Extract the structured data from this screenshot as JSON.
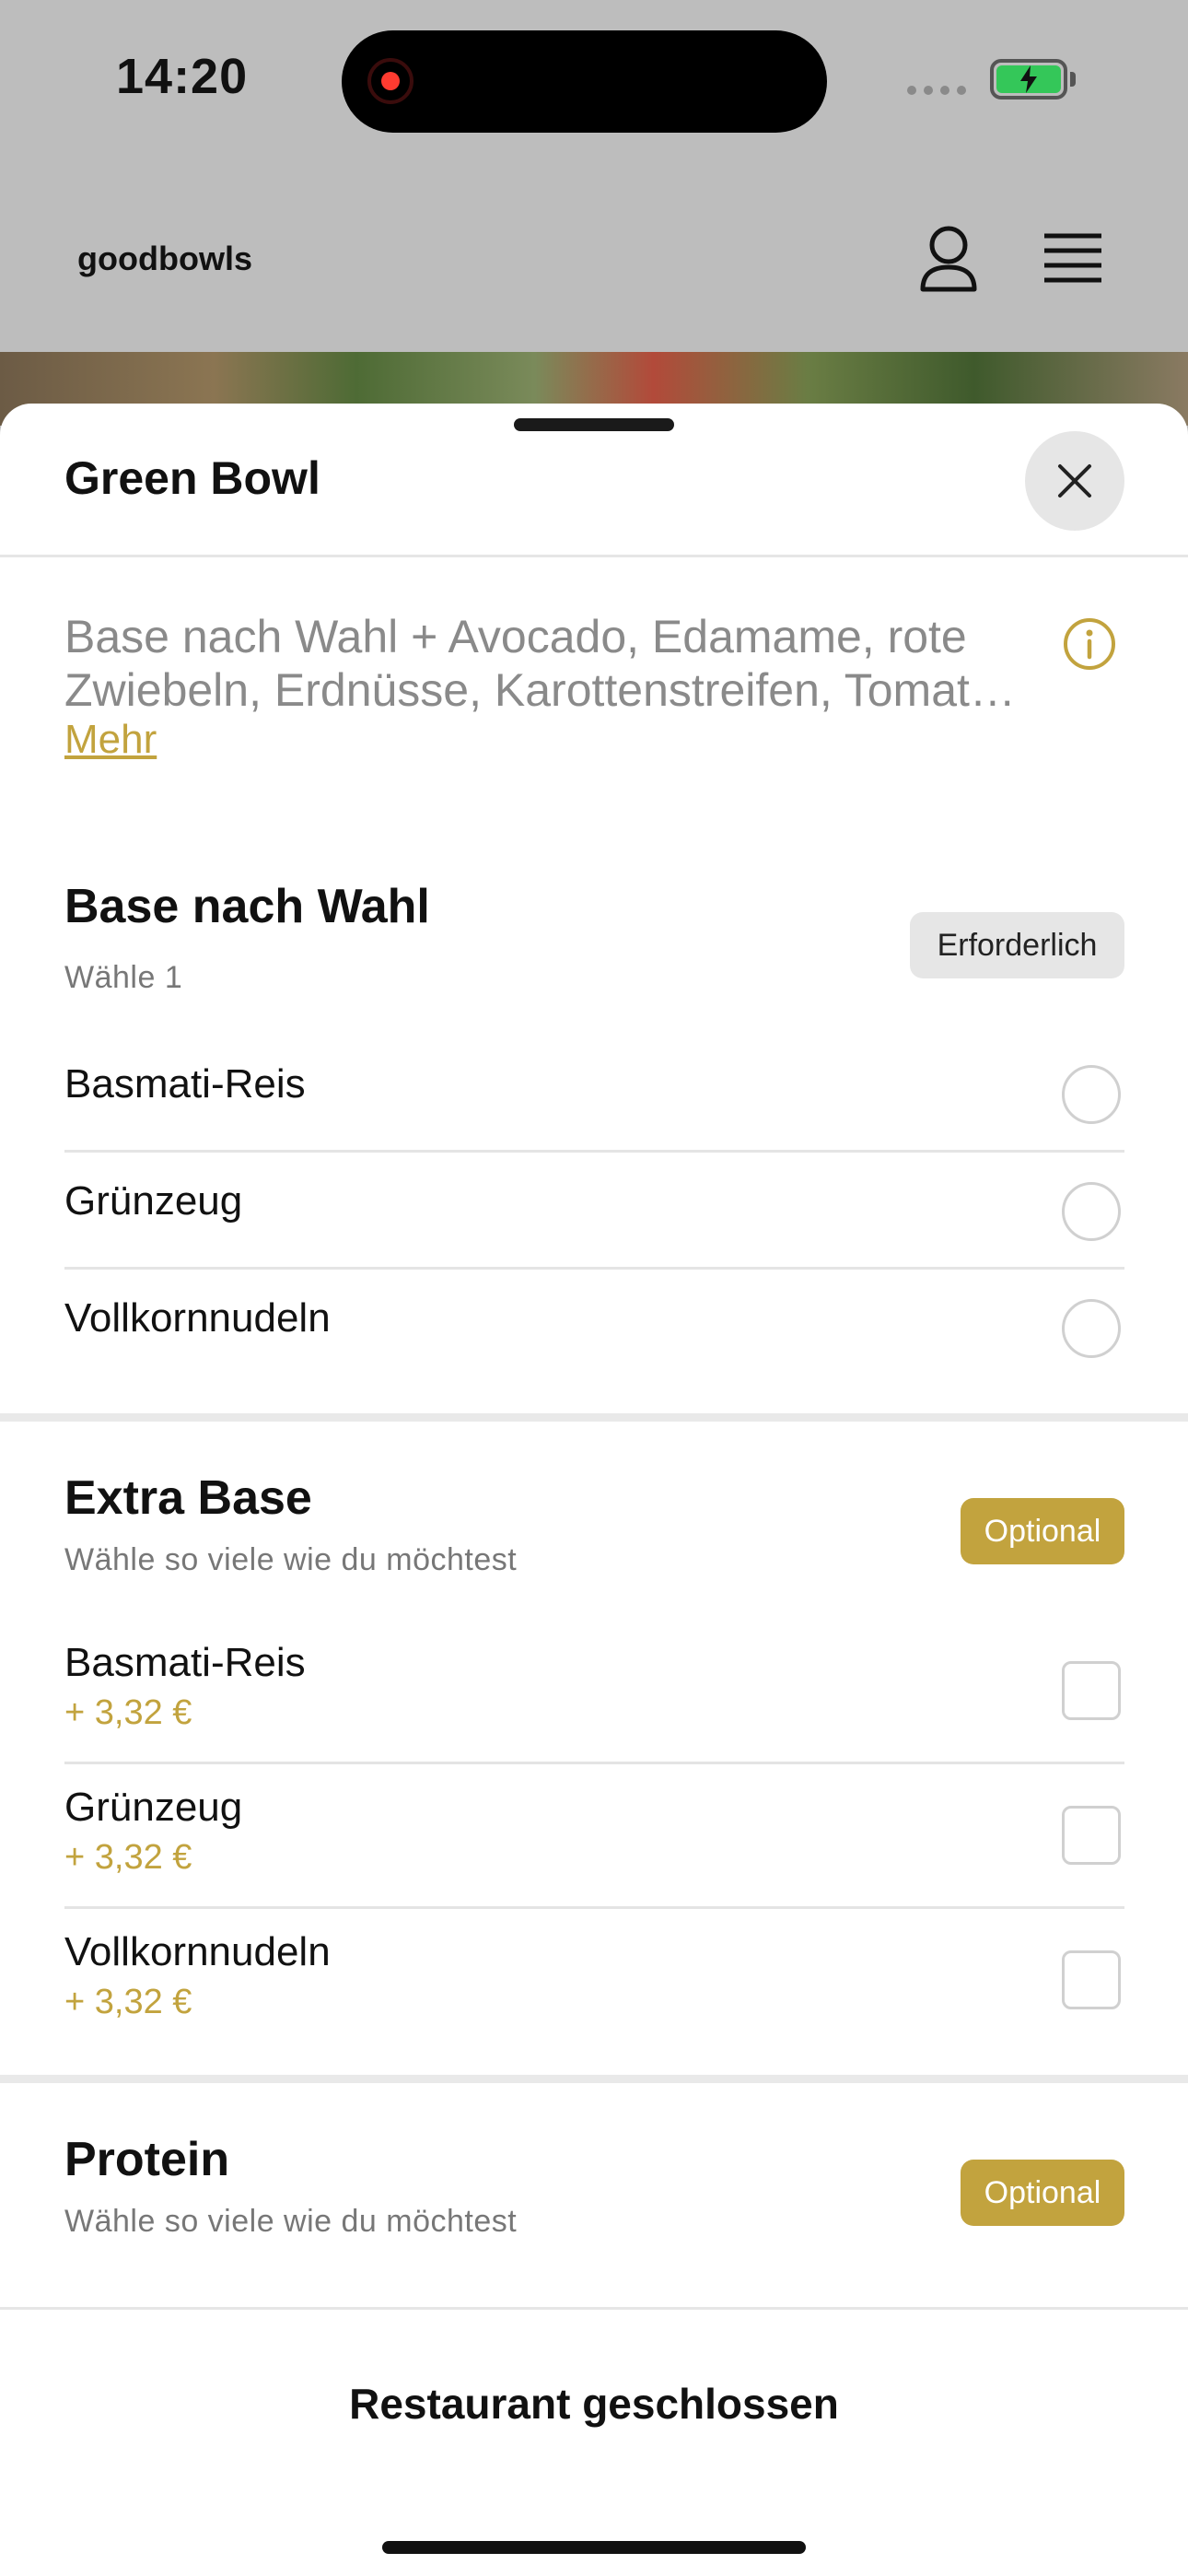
{
  "status_bar": {
    "time": "14:20"
  },
  "header": {
    "brand": "goodbowls"
  },
  "sheet": {
    "title": "Green Bowl",
    "description_line1": "Base nach Wahl + Avocado, Edamame, rote",
    "description_line2": "Zwiebeln, Erdnüsse, Karottenstreifen, Tomat…",
    "more_link": "Mehr"
  },
  "sections": [
    {
      "title": "Base nach Wahl",
      "subtitle": "Wähle 1",
      "badge": "Erforderlich",
      "options": [
        {
          "label": "Basmati-Reis"
        },
        {
          "label": "Grünzeug"
        },
        {
          "label": "Vollkornnudeln"
        }
      ]
    },
    {
      "title": "Extra Base",
      "subtitle": "Wähle so viele wie du möchtest",
      "badge": "Optional",
      "options": [
        {
          "label": "Basmati-Reis",
          "price": "+ 3,32 €"
        },
        {
          "label": "Grünzeug",
          "price": "+ 3,32 €"
        },
        {
          "label": "Vollkornnudeln",
          "price": "+ 3,32 €"
        }
      ]
    },
    {
      "title": "Protein",
      "subtitle": "Wähle so viele wie du möchtest",
      "badge": "Optional"
    }
  ],
  "footer": {
    "status": "Restaurant geschlossen"
  },
  "colors": {
    "accent": "#c2a33e",
    "battery": "#34c759",
    "recording": "#ff3b30"
  },
  "icons": [
    "record-icon",
    "signal-icon",
    "battery-icon",
    "user-icon",
    "menu-icon",
    "close-icon",
    "info-icon"
  ]
}
